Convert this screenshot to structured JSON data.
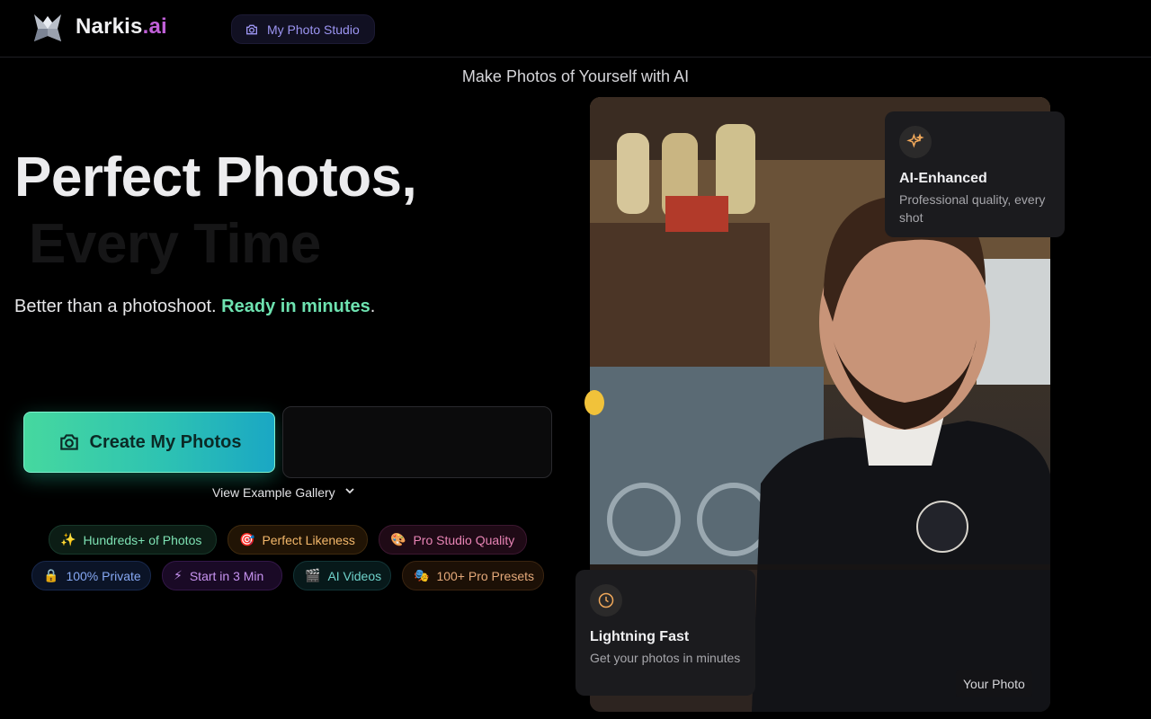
{
  "brand": {
    "name": "Narkis",
    "suffix": ".ai"
  },
  "header": {
    "studio_button": "My Photo Studio"
  },
  "tagline": "Make Photos of Yourself with AI",
  "hero": {
    "title_line1": "Perfect Photos,",
    "title_line2": "Every Time",
    "subtitle_plain": "Better than a photoshoot. ",
    "subtitle_highlight": "Ready in minutes",
    "subtitle_end": "."
  },
  "cta": {
    "label": "Create My Photos"
  },
  "gallery": {
    "label": "View Example Gallery"
  },
  "chips": [
    {
      "icon": "✨",
      "label": "Hundreds+ of Photos"
    },
    {
      "icon": "🎯",
      "label": "Perfect Likeness"
    },
    {
      "icon": "🎨",
      "label": "Pro Studio Quality"
    },
    {
      "icon": "🔒",
      "label": "100% Private"
    },
    {
      "icon": "⚡",
      "label": "Start in 3 Min"
    },
    {
      "icon": "🎬",
      "label": "AI Videos"
    },
    {
      "icon": "🎭",
      "label": "100+ Pro Presets"
    }
  ],
  "cards": {
    "ai": {
      "title": "AI-Enhanced",
      "desc": "Professional quality, every shot"
    },
    "fast": {
      "title": "Lightning Fast",
      "desc": "Get your photos in minutes"
    }
  },
  "photo": {
    "badge": "Your Photo"
  },
  "colors": {
    "accent_green": "#6ee2b0",
    "brand_purple": "#c060d8",
    "cta_start": "#46d89f",
    "cta_end": "#1aa7c4"
  }
}
